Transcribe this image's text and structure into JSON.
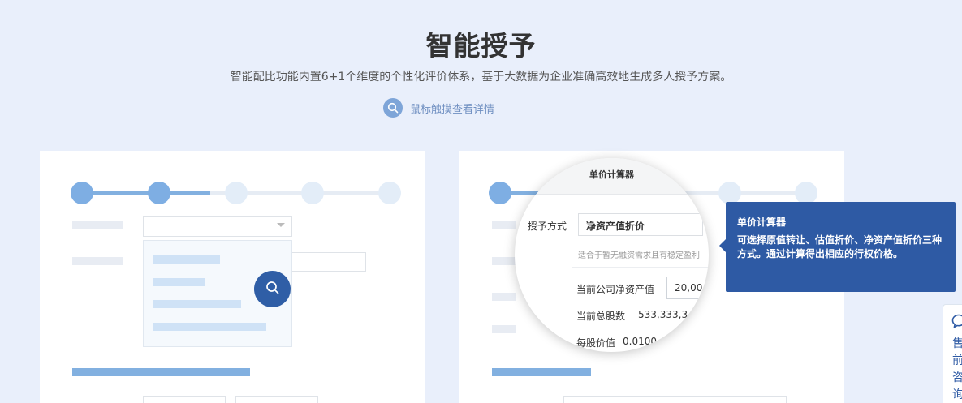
{
  "title": "智能授予",
  "subtitle": "智能配比功能内置6+1个维度的个性化评价体系，基于大数据为企业准确高效地生成多人授予方案。",
  "hover_hint": {
    "icon": "search-icon",
    "label": "鼠标触摸查看详情"
  },
  "left_card": {
    "zoom_icon": "search-icon"
  },
  "right_card": {
    "magnifier": {
      "header": "单价计算器",
      "grant_method_label": "授予方式",
      "grant_method_value": "净资产值折价",
      "hint": "适合于暂无融资需求且有稳定盈利",
      "net_asset_label": "当前公司净资产值",
      "net_asset_value": "20,00",
      "total_shares_label": "当前总股数",
      "total_shares_value": "533,333,3",
      "price_per_share_label": "每股价值",
      "price_per_share_value": "0.0100"
    }
  },
  "tooltip": {
    "title": "单价计算器",
    "body": "可选择原值转让、估值折价、净资产值折价三种方式。通过计算得出相应的行权价格。"
  },
  "side_widget": {
    "icon": "chat-icon",
    "label": "售前咨询"
  },
  "colors": {
    "primary": "#2e5aa4",
    "accent": "#82b0e0",
    "background": "#e9effb"
  }
}
